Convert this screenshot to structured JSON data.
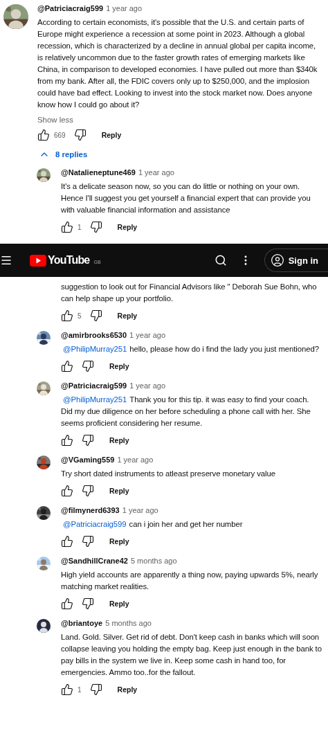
{
  "comment": {
    "author": "@Patriciacraig599",
    "time": "1 year ago",
    "text": "According to certain economists, it's possible that the U.S. and certain parts of Europe might experience a recession at some point in 2023. Although a global recession, which is characterized by a decline in annual global per capita income, is relatively uncommon due to the faster growth rates of emerging markets like China, in comparison to developed economies. I have pulled out more than $340k from my bank. After all, the FDIC covers only up to $250,000, and the implosion could have bad effect. Looking to invest into the stock market now. Does anyone know how I could go about it?",
    "toggle": "Show less",
    "likes": "669",
    "reply": "Reply"
  },
  "replies_toggle": {
    "label": "8 replies",
    "expanded": true
  },
  "header": {
    "logo": "YouTube",
    "region": "GB",
    "sign_in": "Sign in"
  },
  "replies": [
    {
      "kind": "full",
      "author": "@Natalieneptune469",
      "time": "1 year ago",
      "text": "It's a delicate season now, so you can do little or nothing on your own. Hence I'll suggest you get yourself a financial expert that can provide you with valuable financial information and assistance",
      "likes": "1",
      "reply": "Reply"
    },
    {
      "kind": "partial",
      "text": "suggestion to look out for Financial Advisors like \" Deborah Sue Bohn, who can help shape up your portfolio.",
      "likes": "5",
      "reply": "Reply"
    },
    {
      "kind": "full",
      "author": "@amirbrooks6530",
      "time": "1 year ago",
      "mention": "@PhilipMurray251",
      "text": "hello, please how do i find the lady you just mentioned?",
      "reply": "Reply"
    },
    {
      "kind": "full",
      "author": "@Patriciacraig599",
      "time": "1 year ago",
      "mention": "@PhilipMurray251",
      "text": "Thank you for this tip. it was easy to find your coach. Did my due diligence on her before scheduling a phone call with her. She seems proficient considering her resume.",
      "reply": "Reply"
    },
    {
      "kind": "full",
      "author": "@VGaming559",
      "time": "1 year ago",
      "text": "Try short dated instruments to atleast preserve monetary value",
      "reply": "Reply"
    },
    {
      "kind": "full",
      "author": "@filmynerd6393",
      "time": "1 year ago",
      "mention": "@Patriciacraig599",
      "text": "can i join her and get her number",
      "reply": "Reply"
    },
    {
      "kind": "full",
      "author": "@SandhillCrane42",
      "time": "5 months ago",
      "text": "High yield accounts are apparently a thing now, paying upwards 5%, nearly matching market realities.",
      "reply": "Reply"
    },
    {
      "kind": "full",
      "author": "@briantoye",
      "time": "5 months ago",
      "text": "Land. Gold. Silver. Get rid of debt. Don't keep cash in banks which will soon collapse leaving you holding the empty bag. Keep just enough in the bank to pay bills in the system we live in. Keep some cash in hand too, for emergencies. Ammo too..for the fallout.",
      "likes": "1",
      "reply": "Reply"
    }
  ]
}
